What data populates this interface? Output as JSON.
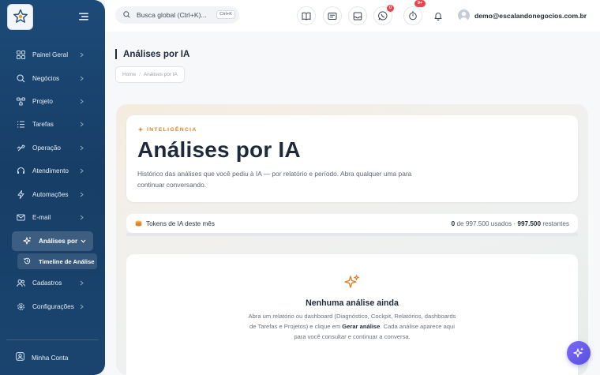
{
  "sidebar": {
    "items": [
      {
        "label": "Painel Geral",
        "icon": "grid-icon"
      },
      {
        "label": "Negócios",
        "icon": "search-icon"
      },
      {
        "label": "Projeto",
        "icon": "flow-icon"
      },
      {
        "label": "Tarefas",
        "icon": "list-icon"
      },
      {
        "label": "Operação",
        "icon": "operation-icon"
      },
      {
        "label": "Atendimento",
        "icon": "headset-icon"
      },
      {
        "label": "Automações",
        "icon": "bolt-icon"
      },
      {
        "label": "E-mail",
        "icon": "mail-icon"
      },
      {
        "label": "Análises por",
        "icon": "sparkle-icon"
      },
      {
        "label": "Timeline de Análise",
        "icon": "history-icon"
      },
      {
        "label": "Cadastros",
        "icon": "users-icon"
      },
      {
        "label": "Configurações",
        "icon": "gear-icon"
      }
    ],
    "account_label": "Minha Conta"
  },
  "topbar": {
    "search_placeholder": "Busca global (Ctrl+K)...",
    "search_shortcut": "Ctrl+K",
    "chat_badge": "0",
    "timer_badge": "9+",
    "user_email": "demo@escalandonegocios.com.br"
  },
  "page": {
    "title": "Análises por IA",
    "breadcrumb": [
      "Home",
      "Análises por IA"
    ]
  },
  "hero": {
    "eyebrow": "INTELIGÊNCIA",
    "title": "Análises por IA",
    "description": "Histórico das análises que você pediu à IA — por relatório e período. Abra qualquer uma para continuar conversando."
  },
  "tokens": {
    "label": "Tokens de IA deste mês",
    "used": "0",
    "used_text": "de 997.500 usados ·",
    "remaining": "997.500",
    "remaining_text": "restantes",
    "used_fraction": 0
  },
  "empty_state": {
    "title": "Nenhuma análise ainda",
    "desc_part1": "Abra um relatório ou dashboard (Diagnóstico, Cockpit, Relatórios, dashboards de Tarefas e Projetos) e clique em ",
    "desc_action": "Gerar análise",
    "desc_part2": ". Cada análise aparece aqui para você consultar e continuar a conversa."
  },
  "colors": {
    "sidebar": "#1c4a78",
    "accent_orange": "#d9822b",
    "badge_red": "#e5484d",
    "fab_purple": "#6a5cf0"
  }
}
